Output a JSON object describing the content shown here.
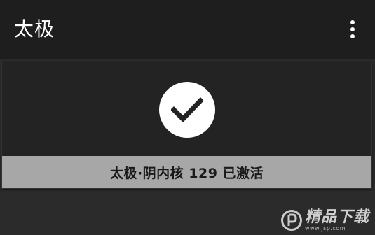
{
  "toolbar": {
    "title": "太极",
    "menu_icon": "more-vert-icon"
  },
  "status": {
    "icon": "check-circle-icon",
    "text": "太极·阴内核 129 已激活",
    "banner_color": "#a7a7a7"
  },
  "watermark": {
    "text": "精品下载",
    "url": "www.jsp.com"
  },
  "colors": {
    "toolbar_bg": "#1e1e1e",
    "page_bg": "#2b2b2b",
    "card_bg": "#232323"
  }
}
